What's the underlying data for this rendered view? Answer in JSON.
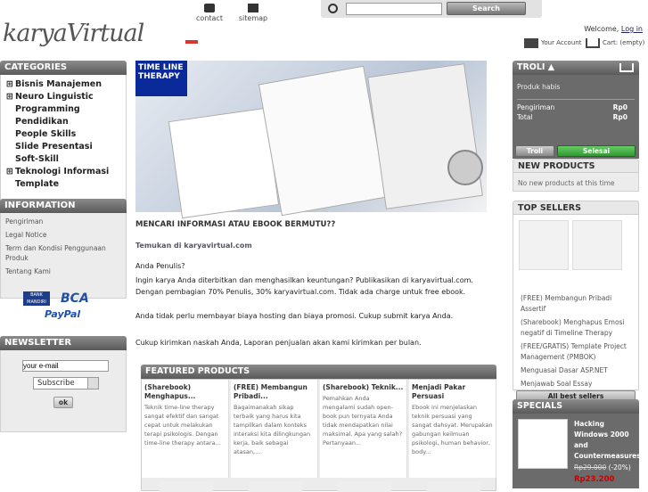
{
  "header": {
    "logo": "karyaVirtual",
    "contact": "contact",
    "sitemap": "sitemap",
    "search_btn": "Search",
    "welcome": "Welcome,",
    "login": "Log in",
    "your_account": "Your Account",
    "cart": "Cart:",
    "cart_empty": "(empty)"
  },
  "categories": {
    "title": "CATEGORIES",
    "items": [
      {
        "label": "Bisnis Manajemen",
        "exp": "⊞"
      },
      {
        "label": "Neuro Linguistic Programming",
        "exp": "⊞"
      },
      {
        "label": "Pendidikan",
        "exp": ""
      },
      {
        "label": "People Skills",
        "exp": ""
      },
      {
        "label": "Slide Presentasi",
        "exp": ""
      },
      {
        "label": "Soft-Skill",
        "exp": ""
      },
      {
        "label": "Teknologi Informasi",
        "exp": "⊞"
      },
      {
        "label": "Template",
        "exp": ""
      }
    ]
  },
  "information": {
    "title": "INFORMATION",
    "items": [
      "Pengiriman",
      "Legal Notice",
      "Term dan Kondisi Penggunaan Produk",
      "Tentang Kami"
    ]
  },
  "payment": {
    "bca": "BCA",
    "paypal": "PayPal"
  },
  "newsletter": {
    "title": "NEWSLETTER",
    "email_value": "your e-mail",
    "select_value": "Subscribe",
    "ok": "ok"
  },
  "main": {
    "heading": "MENCARI INFORMASI ATAU EBOOK BERMUTU??",
    "subheading": "Temukan di karyavirtual.com",
    "p1": "Anda Penulis?",
    "p2": "Ingin karya Anda diterbitkan dan menghasilkan keuntungan? Publikasikan di karyavirtual.com. Dengan pembagian 70% Penulis, 30% karyavirtual.com. Tidak ada charge untuk free ebook.",
    "p3": "Anda tidak perlu membayar biaya hosting dan biaya promosi. Cukup submit karya Anda.",
    "p4": "Cukup kirimkan naskah Anda, Laporan penjualan akan kami kirimkan per bulan."
  },
  "featured": {
    "title": "FEATURED PRODUCTS",
    "products": [
      {
        "name": "(Sharebook) Menghapus...",
        "desc": "Teknik time-line therapy sangat efektif dan sangat cepat untuk melakukan terapi psikologis. Dengan time-line therapy antara..."
      },
      {
        "name": "(FREE) Membangun Pribadi...",
        "desc": "Bagaimanakah sikap terbaik yang harus kita tampilkan dalam konteks interaksi kita dilingkungan kerja, baik sebagai atasan,..."
      },
      {
        "name": "(Sharebook) Teknik...",
        "desc": "Pemahkan Anda mengalami sudah open-book pun ternyata Anda tidak mendapatkan nilai maksimal. Apa yang salah? Pertanyaan..."
      },
      {
        "name": "Menjadi Pakar Persuasi",
        "desc": "Ebook ini menjelaskan teknik persuasi yang sangat dahsyat. Merupakan gabungan keilmuan psikologi, human behavior, body..."
      }
    ]
  },
  "cart": {
    "title": "TROLI ▲",
    "empty": "Produk habis",
    "shipping_label": "Pengiriman",
    "shipping_val": "Rp0",
    "total_label": "Total",
    "total_val": "Rp0",
    "btn_cart": "Troli",
    "btn_checkout": "Selesai"
  },
  "newproducts": {
    "title": "NEW PRODUCTS",
    "text": "No new products at this time"
  },
  "topsellers": {
    "title": "TOP SELLERS",
    "items": [
      "(FREE) Membangun Pribadi Assertif",
      "(Sharebook) Menghapus Emosi negatif di Timeline Therapy",
      "(FREE/GRATIS) Template Project Management (PMBOK)",
      "Menguasai Dasar ASP.NET",
      "Menjawab Soal Essay"
    ],
    "all": "All best sellers"
  },
  "specials": {
    "title": "SPECIALS",
    "name": "Hacking Windows 2000 and Countermeasures",
    "old_price": "Rp29.000",
    "discount": "(-20%)",
    "price": "Rp23.200"
  },
  "colors": {
    "header_grey": "#6e6e6e",
    "checkout_green": "#3da83d",
    "price_red": "#cc0000"
  }
}
